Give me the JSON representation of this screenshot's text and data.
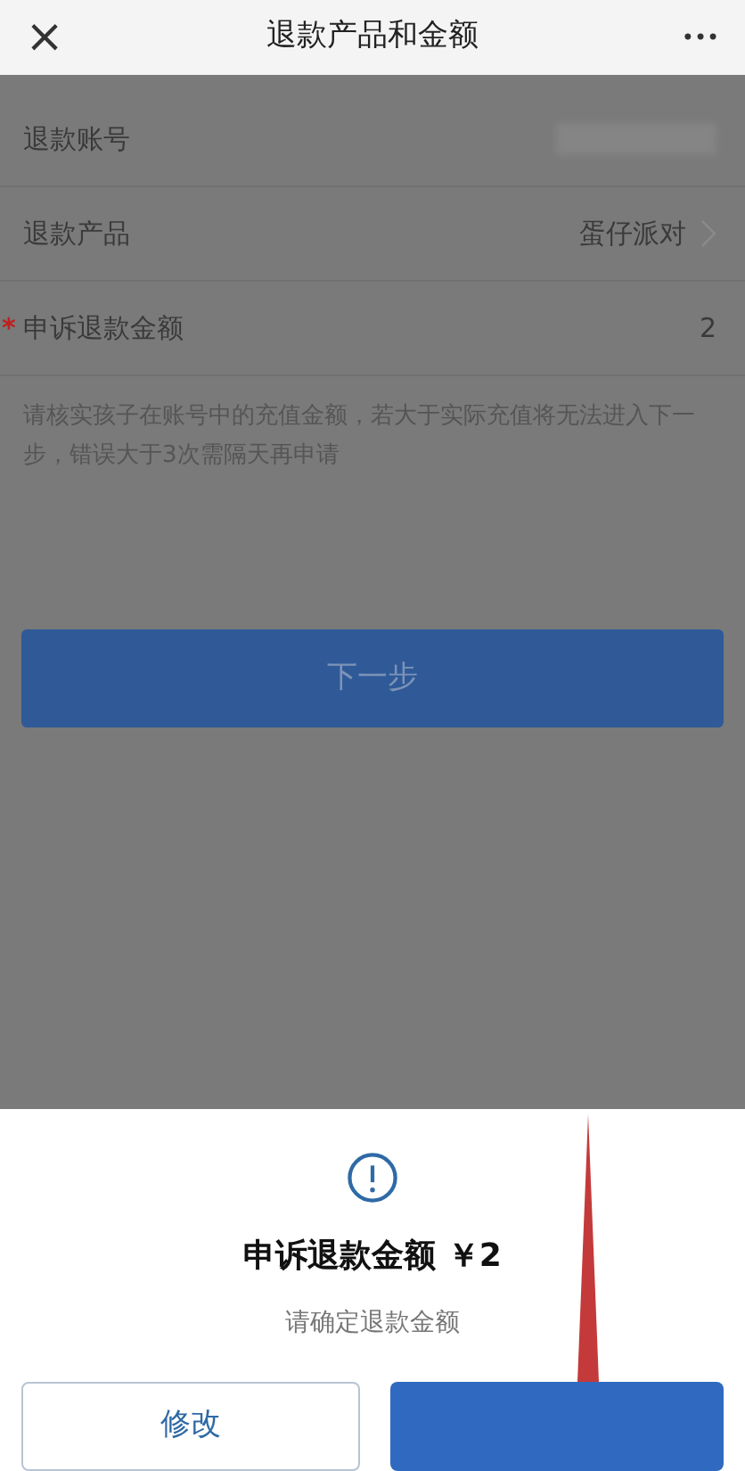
{
  "header": {
    "title": "退款产品和金额",
    "close": "×",
    "more": "•••"
  },
  "fields": [
    {
      "kind": "redacted",
      "label": "退款账号",
      "required": false
    },
    {
      "kind": "link",
      "label": "退款产品",
      "value": "蛋仔派对",
      "required": false
    },
    {
      "kind": "text",
      "label": "申诉退款金额",
      "value": "2",
      "required": true
    }
  ],
  "required_mark": "*",
  "note": "请核实孩子在账号中的充值金额，若大于实际充值将无法进入下一步，错误大于3次需隔天再申请",
  "next_button": "下一步",
  "dialog": {
    "title": "申诉退款金额 ￥2",
    "subtitle": "请确定退款金额",
    "buttons": [
      {
        "kind": "secondary",
        "label": "修改"
      },
      {
        "kind": "primary"
      }
    ]
  }
}
